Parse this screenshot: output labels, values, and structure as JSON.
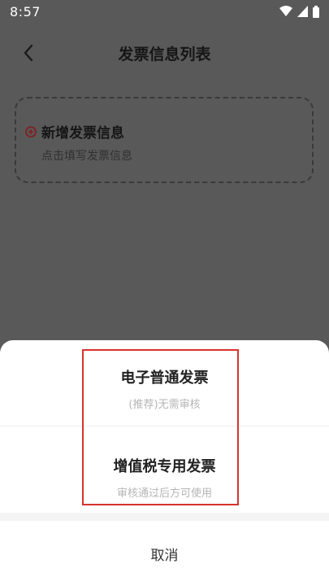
{
  "status_bar": {
    "time": "8:57",
    "icons": [
      "wifi-icon",
      "signal-icon",
      "battery-icon"
    ]
  },
  "header": {
    "title": "发票信息列表",
    "back_icon": "chevron-left-icon"
  },
  "add_invoice": {
    "title": "新增发票信息",
    "subtitle": "点击填写发票信息",
    "icon": "plus-circle-icon",
    "accent": "#7a2626"
  },
  "sheet": {
    "options": [
      {
        "title": "电子普通发票",
        "subtitle": "(推荐)无需审核"
      },
      {
        "title": "增值税专用发票",
        "subtitle": "审核通过后方可使用"
      }
    ],
    "cancel_label": "取消"
  },
  "highlight_color": "#d8332c"
}
